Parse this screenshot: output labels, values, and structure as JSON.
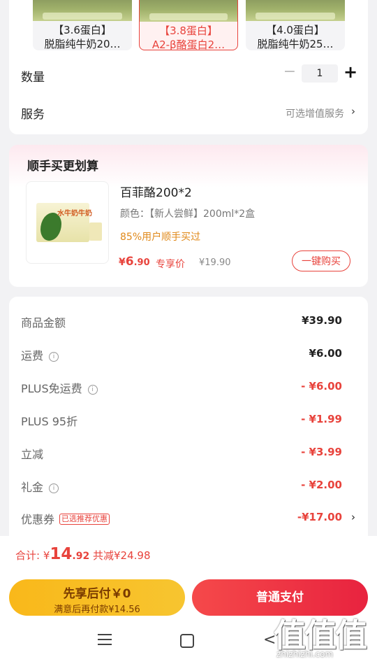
{
  "specs": [
    {
      "line1": "【3.6蛋白】",
      "line2": "脱脂纯牛奶20…",
      "selected": false
    },
    {
      "line1": "【3.8蛋白】",
      "line2": "A2-β酪蛋白2…",
      "selected": true
    },
    {
      "line1": "【4.0蛋白】",
      "line2": "脱脂纯牛奶25…",
      "selected": false
    }
  ],
  "quantity": {
    "label": "数量",
    "minus": "−",
    "value": "1",
    "plus": "+"
  },
  "service": {
    "label": "服务",
    "hint": "可选增值服务",
    "chevron": "›"
  },
  "addon": {
    "title": "顺手买更划算",
    "image_text": "水牛奶牛奶",
    "name": "百菲酪200*2",
    "color": "颜色：【新人尝鲜】200ml*2盒",
    "popularity": "85%用户顺手买过",
    "price_symbol": "¥",
    "price_int": "6",
    "price_dec": ".90",
    "price_tag": "专享价",
    "original_price": "¥19.90",
    "buy_button": "一键购买"
  },
  "summary": {
    "rows": [
      {
        "label": "商品金额",
        "value": "¥39.90",
        "info": false,
        "red": false
      },
      {
        "label": "运费",
        "value": "¥6.00",
        "info": true,
        "red": false
      },
      {
        "label": "PLUS免运费",
        "value": "- ¥6.00",
        "info": true,
        "red": true
      },
      {
        "label": "PLUS 95折",
        "value": "- ¥1.99",
        "info": false,
        "red": true
      },
      {
        "label": "立减",
        "value": "- ¥3.99",
        "info": false,
        "red": true
      },
      {
        "label": "礼金",
        "value": "- ¥2.00",
        "info": true,
        "red": true
      },
      {
        "label": "优惠券",
        "value": "-¥17.00",
        "info": false,
        "red": true
      }
    ],
    "coupon_tag": "已选推荐优惠",
    "coupon_chevron": "›",
    "info_glyph": "i"
  },
  "bottom": {
    "total_label": "合计:",
    "total_symbol": "¥",
    "total_int": "14",
    "total_dec": ".92",
    "saved": "共减¥24.98",
    "credit_line1": "先享后付￥0",
    "credit_line2": "满意后再付款¥14.56",
    "pay_button": "普通支付"
  },
  "nav": {
    "back": "<"
  },
  "watermark": {
    "logo": "值值值",
    "url": "zhizhizhi.com"
  },
  "colors": {
    "accent": "#e8433c",
    "credit": "#f9b81a",
    "popularity": "#e0891a"
  }
}
